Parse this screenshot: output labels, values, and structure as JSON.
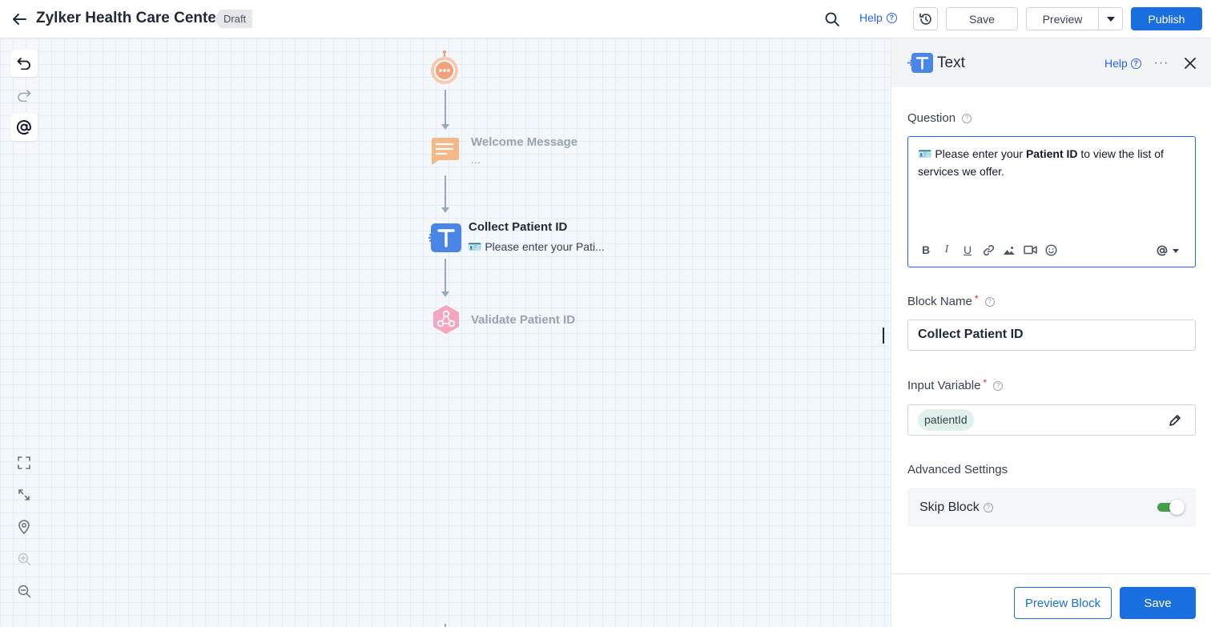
{
  "header": {
    "title": "Zylker Health Care Center",
    "status_badge": "Draft",
    "help_label": "Help",
    "save_label": "Save",
    "preview_label": "Preview",
    "publish_label": "Publish"
  },
  "canvas": {
    "nodes": [
      {
        "title": "Welcome Message",
        "subtitle": "..."
      },
      {
        "title": "Collect Patient ID",
        "subtitle": "🪪 Please enter your Pati..."
      },
      {
        "title": "Validate Patient ID"
      }
    ]
  },
  "panel": {
    "title": "Text",
    "help_label": "Help",
    "question_label": "Question",
    "question_text_prefix": "🪪 Please enter your ",
    "question_text_bold": "Patient ID",
    "question_text_suffix": " to view the list of services we offer.",
    "block_name_label": "Block Name",
    "block_name_value": "Collect Patient ID",
    "input_variable_label": "Input Variable",
    "input_variable_value": "patientId",
    "advanced_settings_label": "Advanced Settings",
    "skip_block_label": "Skip Block",
    "skip_block_enabled": true,
    "preview_block_label": "Preview Block",
    "save_label": "Save"
  },
  "colors": {
    "primary": "#1a6fe0",
    "text_block_icon": "#4a86e8",
    "message_block_icon": "#f4b987",
    "webhook_block_icon": "#f3a6bd",
    "start_node": "#f1a27a",
    "toggle_on": "#43a047"
  }
}
